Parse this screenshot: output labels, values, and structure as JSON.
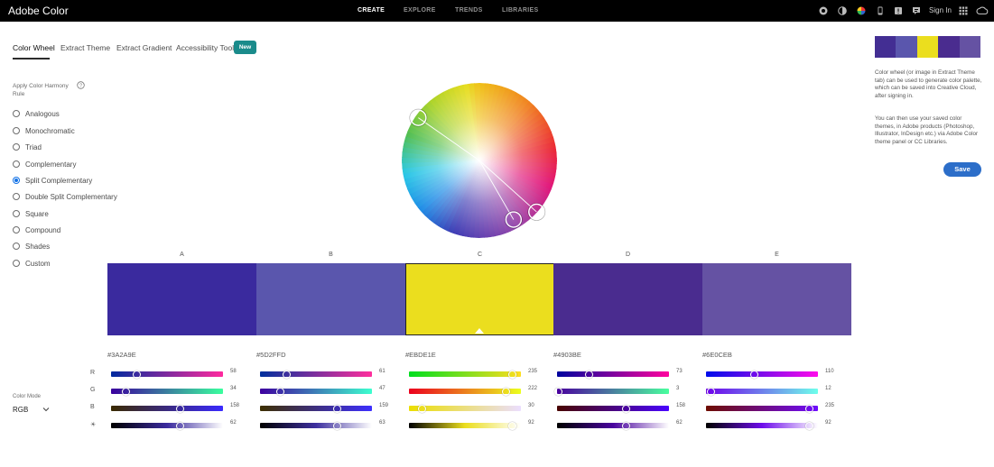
{
  "app": {
    "brand": "Adobe Color",
    "nav": [
      "CREATE",
      "EXPLORE",
      "TRENDS",
      "LIBRARIES"
    ],
    "signin": "Sign In",
    "icons": [
      "circle-icon",
      "contrast-icon",
      "color-wheel-icon",
      "phone-icon",
      "alert-icon",
      "feedback-icon",
      "apps-grid-icon",
      "creative-cloud-icon"
    ]
  },
  "tabs": {
    "color_wheel": "Color Wheel",
    "extract_theme": "Extract Theme",
    "extract_gradient": "Extract Gradient",
    "accessibility_tools": "Accessibility Tools",
    "new_badge": "New"
  },
  "harmony": {
    "heading": "Apply Color Harmony Rule",
    "rules": [
      "Analogous",
      "Monochromatic",
      "Triad",
      "Complementary",
      "Split Complementary",
      "Double Split Complementary",
      "Square",
      "Compound",
      "Shades",
      "Custom"
    ],
    "selected": "Split Complementary"
  },
  "color_mode": {
    "label": "Color Mode",
    "value": "RGB"
  },
  "channels": [
    "R",
    "G",
    "B",
    "☀"
  ],
  "swatches": [
    {
      "letter": "A",
      "hex": "#3A2A9E",
      "color": "#3a2a9e",
      "values": [
        "58",
        "34",
        "158",
        "62"
      ],
      "levels": [
        0.227,
        0.133,
        0.62,
        0.62
      ],
      "gradients": [
        "linear-gradient(to right,#002a9e,#ff2a9e)",
        "linear-gradient(to right,#3a009e,#3aff9e)",
        "linear-gradient(to right,#3a2a00,#3a2aff)",
        "linear-gradient(to right,#000000,#3a2a9e,#ffffff)"
      ]
    },
    {
      "letter": "B",
      "hex": "#5D2FFD",
      "color": "#5a56ad",
      "values": [
        "61",
        "47",
        "159",
        "63"
      ],
      "levels": [
        0.24,
        0.184,
        0.69,
        0.69
      ],
      "gradients": [
        "linear-gradient(to right,#002f9d,#ff2f9d)",
        "linear-gradient(to right,#3d009f,#3dffcf)",
        "linear-gradient(to right,#3d2f00,#3d2fff)",
        "linear-gradient(to right,#000000,#3d2f9f,#ffffff)"
      ]
    },
    {
      "letter": "C",
      "hex": "#EBDE1E",
      "color": "#ebde1e",
      "values": [
        "235",
        "222",
        "30",
        "92"
      ],
      "levels": [
        0.92,
        0.87,
        0.12,
        0.92
      ],
      "gradients": [
        "linear-gradient(to right,#00de1e,#ffde1e)",
        "linear-gradient(to right,#eb001e,#ebff1e)",
        "linear-gradient(to right,#ebde00,#ebdeff)",
        "linear-gradient(to right,#000000,#ebde1e,#ffffff)"
      ]
    },
    {
      "letter": "D",
      "hex": "#4903BE",
      "color": "#4a2c8f",
      "values": [
        "73",
        "3",
        "158",
        "62"
      ],
      "levels": [
        0.286,
        0.012,
        0.62,
        0.62
      ],
      "gradients": [
        "linear-gradient(to right,#00039e,#ff039e)",
        "linear-gradient(to right,#49009e,#49ff9e)",
        "linear-gradient(to right,#490300,#4903ff)",
        "linear-gradient(to right,#000000,#49039e,#ffffff)"
      ]
    },
    {
      "letter": "E",
      "hex": "#6E0CEB",
      "color": "#6552a3",
      "values": [
        "110",
        "12",
        "235",
        "92"
      ],
      "levels": [
        0.431,
        0.047,
        0.92,
        0.92
      ],
      "gradients": [
        "linear-gradient(to right,#000ceb,#ff0ceb)",
        "linear-gradient(to right,#6e00eb,#6effeb)",
        "linear-gradient(to right,#6e0c00,#6e0cff)",
        "linear-gradient(to right,#000000,#6e0ceb,#ffffff)"
      ]
    }
  ],
  "side": {
    "palette": [
      "#432e93",
      "#5a56ad",
      "#ebde1e",
      "#4a2c8f",
      "#6552a3"
    ],
    "text1": "Color wheel (or image in Extract Theme tab) can be used to generate color palette, which can be saved into Creative Cloud, after signing in.",
    "text2": "You can then use your saved color themes, in Adobe products (Photoshop, Illustrator, InDesign etc.) via Adobe Color theme panel or CC Libraries.",
    "save": "Save"
  },
  "wheel": {
    "handles": [
      {
        "angle": -55,
        "radius": 0.96
      },
      {
        "angle": 150,
        "radius": 0.88
      },
      {
        "angle": 132,
        "radius": 0.99
      }
    ]
  }
}
